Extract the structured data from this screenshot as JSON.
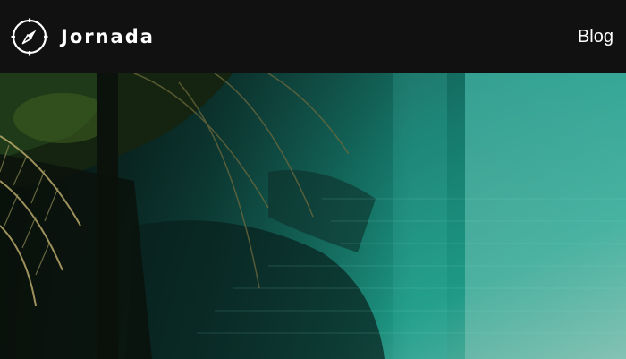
{
  "header": {
    "brand_name": "Jornada",
    "logo_icon": "compass-icon",
    "nav_links": [
      {
        "label": "Blog"
      }
    ]
  },
  "hero": {
    "image_subject": "tropical-lagoon-palms-photo"
  },
  "colors": {
    "header_bg": "#111111",
    "header_text": "#ffffff",
    "water_teal": "#1e8f7e",
    "foliage_dark": "#1a2a14"
  }
}
